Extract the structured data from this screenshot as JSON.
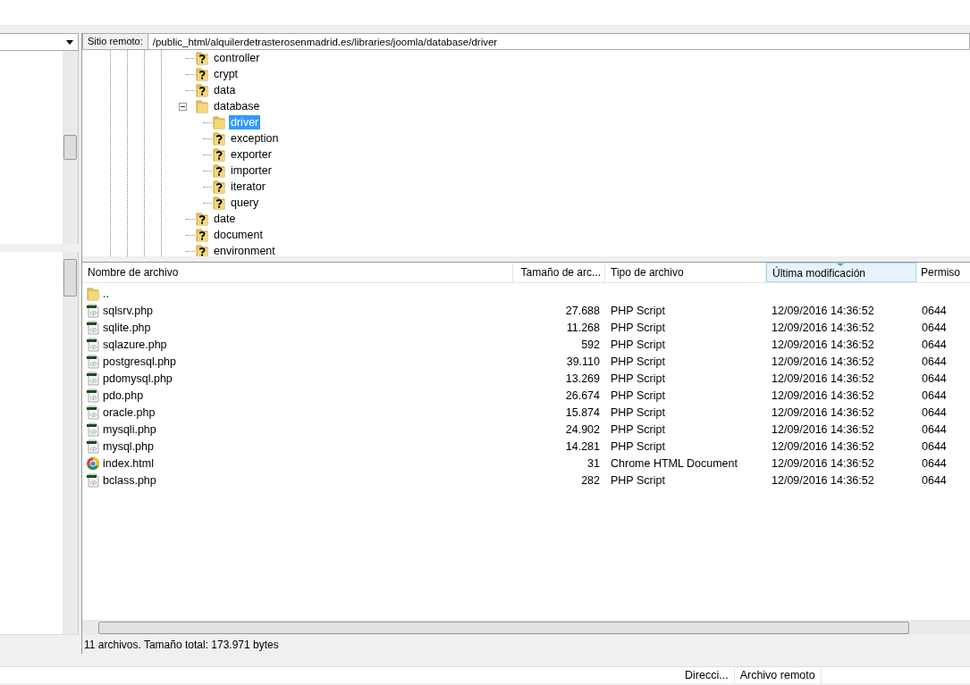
{
  "remote_panel": {
    "path_label": "Sitio remoto:",
    "path_field": {
      "value": "/public_html/alquilerdetrasterosenmadrid.es/libraries/joomla/database/driver"
    },
    "tree": [
      {
        "label": "controller",
        "kind": "unknown",
        "selected": false
      },
      {
        "label": "crypt",
        "kind": "unknown",
        "selected": false
      },
      {
        "label": "data",
        "kind": "unknown",
        "selected": false
      },
      {
        "label": "database",
        "kind": "folder",
        "selected": false,
        "expanded": true,
        "children": [
          {
            "label": "driver",
            "kind": "folder",
            "selected": true
          },
          {
            "label": "exception",
            "kind": "unknown",
            "selected": false
          },
          {
            "label": "exporter",
            "kind": "unknown",
            "selected": false
          },
          {
            "label": "importer",
            "kind": "unknown",
            "selected": false
          },
          {
            "label": "iterator",
            "kind": "unknown",
            "selected": false
          },
          {
            "label": "query",
            "kind": "unknown",
            "selected": false
          }
        ]
      },
      {
        "label": "date",
        "kind": "unknown",
        "selected": false
      },
      {
        "label": "document",
        "kind": "unknown",
        "selected": false
      },
      {
        "label": "environment",
        "kind": "unknown",
        "selected": false
      }
    ],
    "columns": [
      {
        "label": "Nombre de archivo",
        "sorted": false
      },
      {
        "label": "Tamaño de arc...",
        "sorted": false
      },
      {
        "label": "Tipo de archivo",
        "sorted": false
      },
      {
        "label": "Última modificación",
        "sorted": true
      },
      {
        "label": "Permiso",
        "sorted": false
      }
    ],
    "rows": [
      {
        "kind": "folder",
        "name": ".."
      },
      {
        "kind": "php",
        "name": "sqlsrv.php",
        "size": "27.688",
        "type": "PHP Script",
        "modified": "12/09/2016 14:36:52",
        "perms": "0644"
      },
      {
        "kind": "php",
        "name": "sqlite.php",
        "size": "11.268",
        "type": "PHP Script",
        "modified": "12/09/2016 14:36:52",
        "perms": "0644"
      },
      {
        "kind": "php",
        "name": "sqlazure.php",
        "size": "592",
        "type": "PHP Script",
        "modified": "12/09/2016 14:36:52",
        "perms": "0644"
      },
      {
        "kind": "php",
        "name": "postgresql.php",
        "size": "39.110",
        "type": "PHP Script",
        "modified": "12/09/2016 14:36:52",
        "perms": "0644"
      },
      {
        "kind": "php",
        "name": "pdomysql.php",
        "size": "13.269",
        "type": "PHP Script",
        "modified": "12/09/2016 14:36:52",
        "perms": "0644"
      },
      {
        "kind": "php",
        "name": "pdo.php",
        "size": "26.674",
        "type": "PHP Script",
        "modified": "12/09/2016 14:36:52",
        "perms": "0644"
      },
      {
        "kind": "php",
        "name": "oracle.php",
        "size": "15.874",
        "type": "PHP Script",
        "modified": "12/09/2016 14:36:52",
        "perms": "0644"
      },
      {
        "kind": "php",
        "name": "mysqli.php",
        "size": "24.902",
        "type": "PHP Script",
        "modified": "12/09/2016 14:36:52",
        "perms": "0644"
      },
      {
        "kind": "php",
        "name": "mysql.php",
        "size": "14.281",
        "type": "PHP Script",
        "modified": "12/09/2016 14:36:52",
        "perms": "0644"
      },
      {
        "kind": "html",
        "name": "index.html",
        "size": "31",
        "type": "Chrome HTML Document",
        "modified": "12/09/2016 14:36:52",
        "perms": "0644"
      },
      {
        "kind": "php",
        "name": "bclass.php",
        "size": "282",
        "type": "PHP Script",
        "modified": "12/09/2016 14:36:52",
        "perms": "0644"
      }
    ],
    "status": "11 archivos. Tamaño total: 173.971 bytes"
  },
  "queue": {
    "columns": [
      "Direcci...",
      "Archivo remoto"
    ]
  }
}
